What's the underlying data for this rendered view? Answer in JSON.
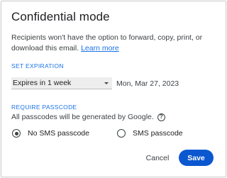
{
  "dialog": {
    "title": "Confidential mode",
    "description": "Recipients won't have the option to forward, copy, print, or download this email.",
    "learn_more": "Learn more"
  },
  "expiration": {
    "section_label": "SET EXPIRATION",
    "selected": "Expires in 1 week",
    "date": "Mon, Mar 27, 2023"
  },
  "passcode": {
    "section_label": "REQUIRE PASSCODE",
    "note": "All passcodes will be generated by Google.",
    "help_glyph": "?",
    "options": [
      {
        "label": "No SMS passcode",
        "selected": true
      },
      {
        "label": "SMS passcode",
        "selected": false
      }
    ]
  },
  "actions": {
    "cancel_label": "Cancel",
    "save_label": "Save"
  },
  "colors": {
    "accent": "#1a73e8",
    "save_button": "#0b57d0"
  },
  "icons": {
    "dropdown": "caret-down-icon",
    "help": "help-circle-icon"
  }
}
